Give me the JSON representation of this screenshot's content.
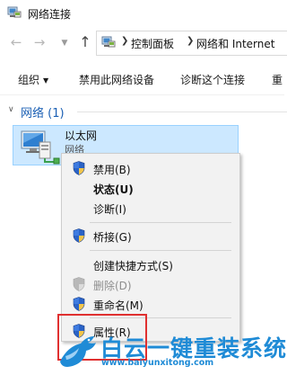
{
  "window": {
    "title": "网络连接"
  },
  "address": {
    "crumbs": [
      "控制面板",
      "网络和 Internet"
    ]
  },
  "toolbar": {
    "organize": "组织",
    "disable_device": "禁用此网络设备",
    "diagnose": "诊断这个连接",
    "rename_truncated": "重"
  },
  "group": {
    "title": "网络 (1)"
  },
  "adapter": {
    "name": "以太网",
    "subtitle": "网络"
  },
  "context_menu": {
    "disable": "禁用(B)",
    "status": "状态(U)",
    "diagnose": "诊断(I)",
    "bridge": "桥接(G)",
    "create_shortcut": "创建快捷方式(S)",
    "delete": "删除(D)",
    "rename": "重命名(M)",
    "properties": "属性(R)"
  },
  "watermark": {
    "title": "白云一键重装系统",
    "url": "www.baiyunxitong.com"
  },
  "colors": {
    "selection_bg": "#cce8ff",
    "selection_border": "#99d1ff",
    "menu_bg": "#f2f2f2",
    "group_title": "#1a5fb4",
    "highlight": "#e03030",
    "watermark": "#1f8bd6"
  }
}
